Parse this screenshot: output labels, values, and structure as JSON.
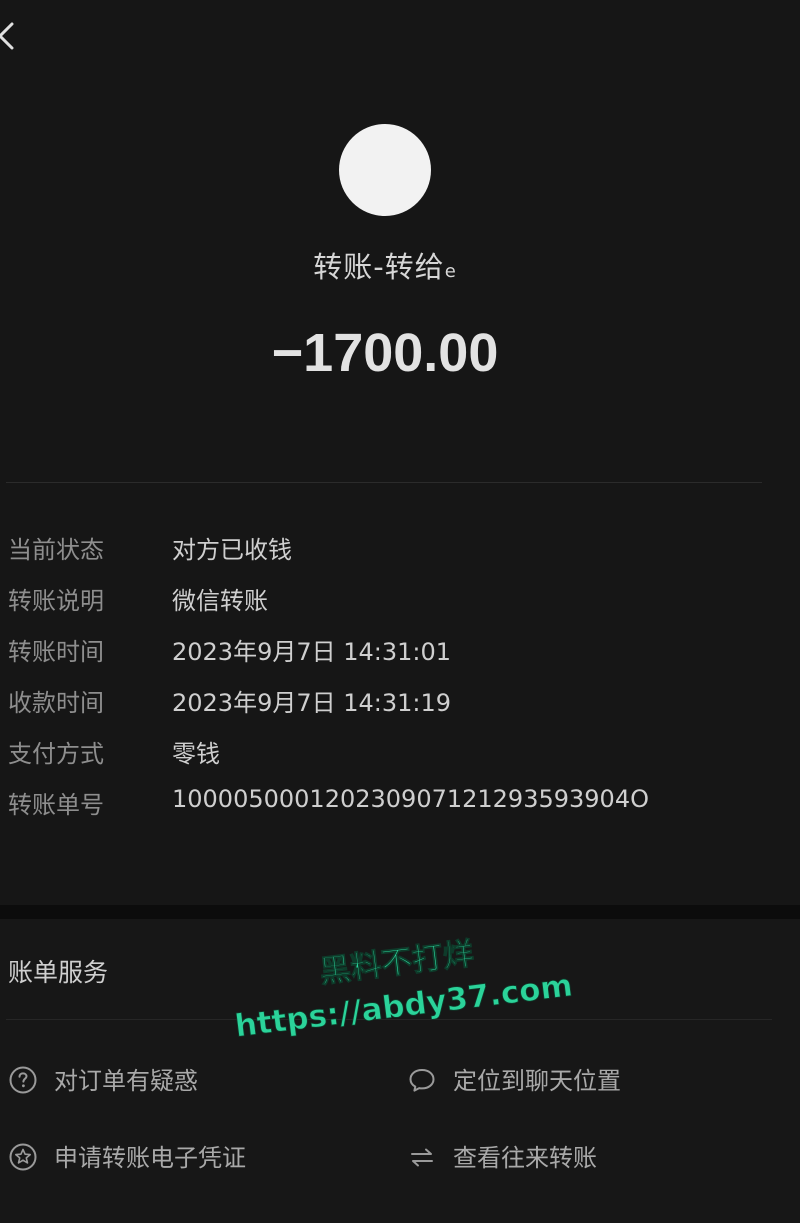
{
  "header": {
    "title": "转账-转给",
    "title_suffix": "e",
    "amount": "−1700.00"
  },
  "details": [
    {
      "label": "当前状态",
      "value": "对方已收钱"
    },
    {
      "label": "转账说明",
      "value": "微信转账"
    },
    {
      "label": "转账时间",
      "value": "2023年9月7日 14:31:01"
    },
    {
      "label": "收款时间",
      "value": "2023年9月7日 14:31:19"
    },
    {
      "label": "支付方式",
      "value": "零钱"
    },
    {
      "label": "转账单号",
      "value": "100005000120230907121293593904O"
    }
  ],
  "services": {
    "title": "账单服务",
    "items": [
      {
        "label": "对订单有疑惑",
        "icon": "question-circle-icon"
      },
      {
        "label": "定位到聊天位置",
        "icon": "chat-bubble-icon"
      },
      {
        "label": "申请转账电子凭证",
        "icon": "certificate-star-icon"
      },
      {
        "label": "查看往来转账",
        "icon": "swap-arrows-icon"
      }
    ]
  },
  "watermark": {
    "line1": "黑料不打烊",
    "line2": "https://abdy37.com"
  },
  "colors": {
    "background": "#161616",
    "watermark": "#2bd39a"
  }
}
